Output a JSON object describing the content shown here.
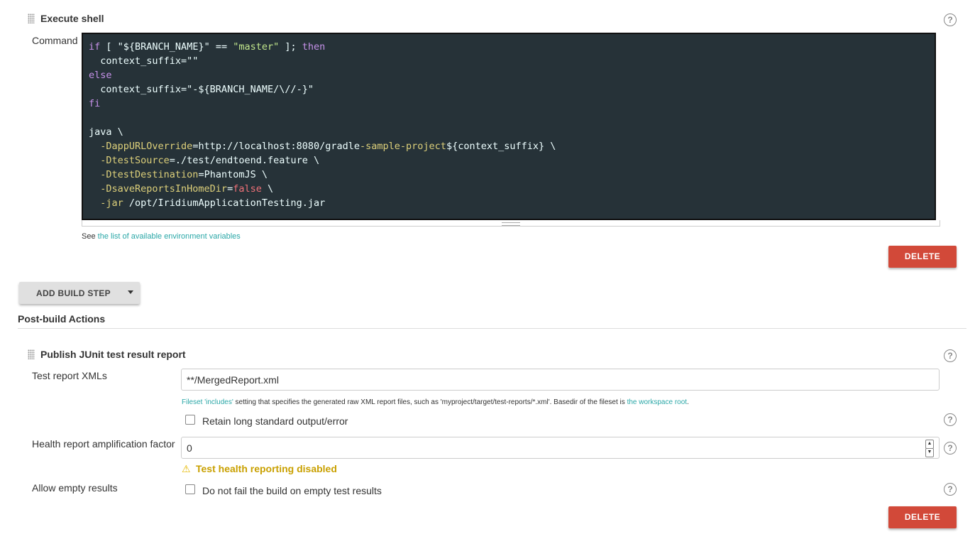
{
  "execute_shell": {
    "title": "Execute shell",
    "command_label": "Command",
    "code_lines": [
      [
        {
          "t": "if",
          "c": "k"
        },
        {
          "t": " [ ",
          "c": "p"
        },
        {
          "t": "\"${BRANCH_NAME}\"",
          "c": "p"
        },
        {
          "t": " == ",
          "c": "p"
        },
        {
          "t": "\"master\"",
          "c": "s"
        },
        {
          "t": " ]; ",
          "c": "p"
        },
        {
          "t": "then",
          "c": "k"
        }
      ],
      [
        {
          "t": "  context_suffix=\"\"",
          "c": "p"
        }
      ],
      [
        {
          "t": "else",
          "c": "k"
        }
      ],
      [
        {
          "t": "  context_suffix=\"-${BRANCH_NAME/\\//-}\"",
          "c": "p"
        }
      ],
      [
        {
          "t": "fi",
          "c": "k"
        }
      ],
      [],
      [
        {
          "t": "java \\",
          "c": "p"
        }
      ],
      [
        {
          "t": "  -DappURLOverride",
          "c": "o"
        },
        {
          "t": "=http://localhost:8080/gradle",
          "c": "p"
        },
        {
          "t": "-sample-project",
          "c": "o"
        },
        {
          "t": "${context_suffix} \\",
          "c": "p"
        }
      ],
      [
        {
          "t": "  -DtestSource",
          "c": "o"
        },
        {
          "t": "=./test/endtoend.feature \\",
          "c": "p"
        }
      ],
      [
        {
          "t": "  -DtestDestination",
          "c": "o"
        },
        {
          "t": "=PhantomJS \\",
          "c": "p"
        }
      ],
      [
        {
          "t": "  -DsaveReportsInHomeDir",
          "c": "o"
        },
        {
          "t": "=",
          "c": "p"
        },
        {
          "t": "false",
          "c": "f"
        },
        {
          "t": " \\",
          "c": "p"
        }
      ],
      [
        {
          "t": "  -jar",
          "c": "o"
        },
        {
          "t": " /opt/IridiumApplicationTesting.jar",
          "c": "p"
        }
      ]
    ],
    "see_prefix": "See",
    "see_link": "the list of available environment variables",
    "delete_label": "DELETE"
  },
  "add_build_step": "ADD BUILD STEP",
  "post_build_title": "Post-build Actions",
  "junit": {
    "title": "Publish JUnit test result report",
    "xml_label": "Test report XMLs",
    "xml_value": "**/MergedReport.xml",
    "hint_link1": "Fileset 'includes'",
    "hint_text": " setting that specifies the generated raw XML report files, such as 'myproject/target/test-reports/*.xml'. Basedir of the fileset is ",
    "hint_link2": "the workspace root",
    "hint_end": ".",
    "retain_label": "Retain long standard output/error",
    "health_label": "Health report amplification factor",
    "health_value": "0",
    "health_warning": "Test health reporting disabled",
    "empty_label": "Allow empty results",
    "empty_cb_label": "Do not fail the build on empty test results",
    "delete_label": "DELETE"
  },
  "help_glyph": "?"
}
